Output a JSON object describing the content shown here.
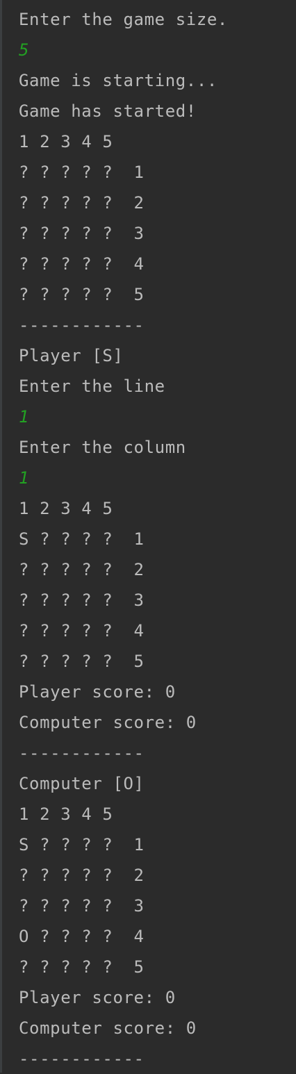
{
  "console": {
    "colors": {
      "background": "#2b2b2b",
      "output_text": "#bbbbbb",
      "user_input": "#22a122"
    },
    "lines": [
      {
        "text": "Enter the game size.",
        "kind": "output"
      },
      {
        "text": "5",
        "kind": "input"
      },
      {
        "text": "Game is starting...",
        "kind": "output"
      },
      {
        "text": "Game has started!",
        "kind": "output"
      },
      {
        "text": "1 2 3 4 5",
        "kind": "output"
      },
      {
        "text": "? ? ? ? ?  1",
        "kind": "output"
      },
      {
        "text": "? ? ? ? ?  2",
        "kind": "output"
      },
      {
        "text": "? ? ? ? ?  3",
        "kind": "output"
      },
      {
        "text": "? ? ? ? ?  4",
        "kind": "output"
      },
      {
        "text": "? ? ? ? ?  5",
        "kind": "output"
      },
      {
        "text": "------------",
        "kind": "output"
      },
      {
        "text": "Player [S]",
        "kind": "output"
      },
      {
        "text": "Enter the line",
        "kind": "output"
      },
      {
        "text": "1",
        "kind": "input"
      },
      {
        "text": "Enter the column",
        "kind": "output"
      },
      {
        "text": "1",
        "kind": "input"
      },
      {
        "text": "1 2 3 4 5",
        "kind": "output"
      },
      {
        "text": "S ? ? ? ?  1",
        "kind": "output"
      },
      {
        "text": "? ? ? ? ?  2",
        "kind": "output"
      },
      {
        "text": "? ? ? ? ?  3",
        "kind": "output"
      },
      {
        "text": "? ? ? ? ?  4",
        "kind": "output"
      },
      {
        "text": "? ? ? ? ?  5",
        "kind": "output"
      },
      {
        "text": "Player score: 0",
        "kind": "output"
      },
      {
        "text": "Computer score: 0",
        "kind": "output"
      },
      {
        "text": "------------",
        "kind": "output"
      },
      {
        "text": "Computer [O]",
        "kind": "output"
      },
      {
        "text": "1 2 3 4 5",
        "kind": "output"
      },
      {
        "text": "S ? ? ? ?  1",
        "kind": "output"
      },
      {
        "text": "? ? ? ? ?  2",
        "kind": "output"
      },
      {
        "text": "? ? ? ? ?  3",
        "kind": "output"
      },
      {
        "text": "O ? ? ? ?  4",
        "kind": "output"
      },
      {
        "text": "? ? ? ? ?  5",
        "kind": "output"
      },
      {
        "text": "Player score: 0",
        "kind": "output"
      },
      {
        "text": "Computer score: 0",
        "kind": "output"
      },
      {
        "text": "------------",
        "kind": "output"
      }
    ]
  }
}
